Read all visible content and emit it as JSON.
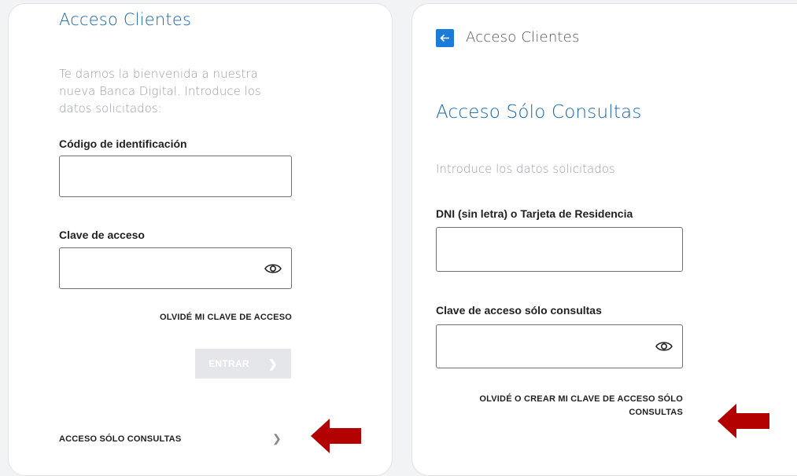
{
  "left": {
    "title": "Acceso Clientes",
    "intro": "Te damos la bienvenida a nuestra nueva Banca Digital. Introduce los datos solicitados:",
    "id_label": "Código de identificación",
    "id_value": "",
    "password_label": "Clave de acceso",
    "password_value": "",
    "forgot_link": "OLVIDÉ MI CLAVE DE ACCESO",
    "enter_button": "ENTRAR",
    "consult_link": "ACCESO SÓLO CONSULTAS"
  },
  "right": {
    "back_title": "Acceso Clientes",
    "title": "Acceso Sólo Consultas",
    "intro": "Introduce los datos solicitados",
    "dni_label": "DNI (sin letra) o Tarjeta de Residencia",
    "dni_value": "",
    "password_label": "Clave de acceso sólo consultas",
    "password_value": "",
    "forgot_link": "OLVIDÉ O CREAR MI CLAVE DE ACCESO SÓLO CONSULTAS"
  },
  "icons": {
    "eye": "eye-icon",
    "chevron": "chevron-right-icon",
    "back": "arrow-left-icon",
    "annotation": "red-arrow-icon"
  },
  "colors": {
    "brand_blue": "#1565b0",
    "back_button": "#1a7bd8",
    "annotation_red": "#b30000",
    "disabled_button": "#e4e6e9"
  }
}
